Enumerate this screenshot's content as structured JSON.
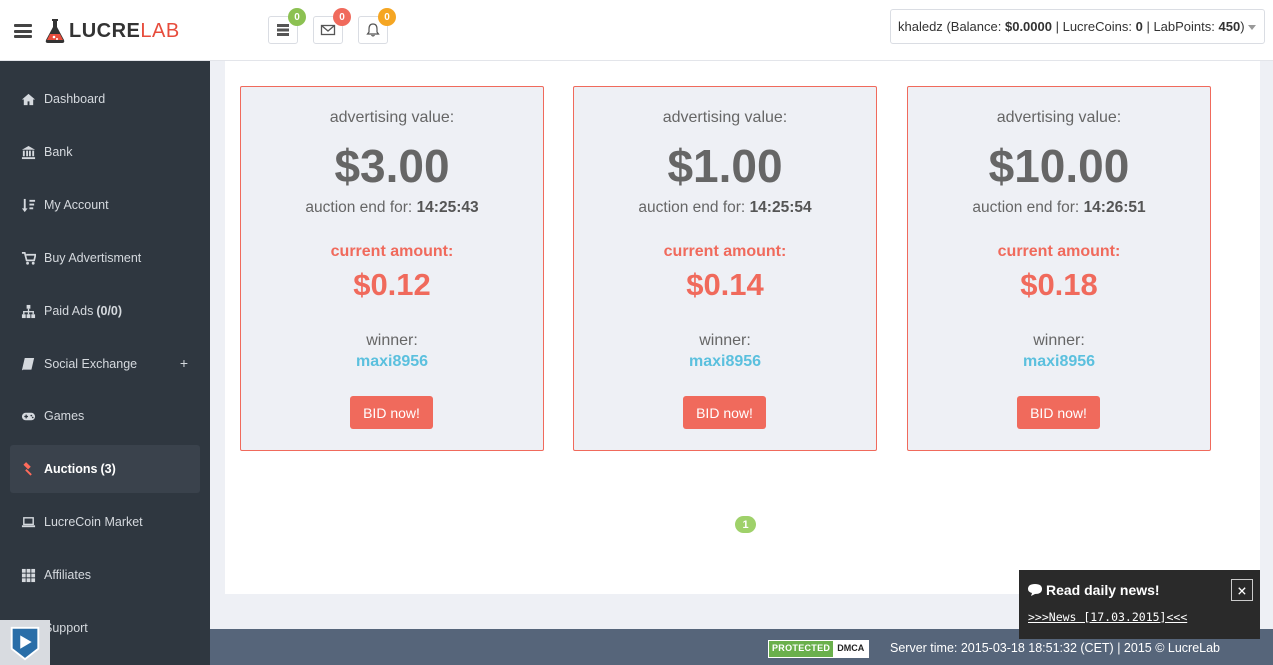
{
  "header": {
    "logo_main": "LUCRE",
    "logo_accent": "LAB",
    "badges": [
      {
        "icon": "server-icon",
        "count": "0",
        "color": "#8cc152"
      },
      {
        "icon": "envelope-icon",
        "count": "0",
        "color": "#f06a5c"
      },
      {
        "icon": "bell-icon",
        "count": "0",
        "color": "#f5a623"
      }
    ],
    "user": {
      "name": "khaledz",
      "balance_label": "(Balance:",
      "balance": "$0.0000",
      "coins_label": "| LucreCoins:",
      "coins": "0",
      "points_label": "| LabPoints:",
      "points": "450",
      "close": ")"
    }
  },
  "sidebar": {
    "items": [
      {
        "label": "Dashboard",
        "icon": "home-icon"
      },
      {
        "label": "Bank",
        "icon": "bank-icon"
      },
      {
        "label": "My Account",
        "icon": "sort-icon"
      },
      {
        "label": "Buy Advertisment",
        "icon": "cart-icon"
      },
      {
        "label": "Paid Ads",
        "count": "(0/0)",
        "icon": "sitemap-icon"
      },
      {
        "label": "Social Exchange",
        "icon": "book-icon",
        "expand": "+"
      },
      {
        "label": "Games",
        "icon": "gamepad-icon"
      },
      {
        "label": "Auctions",
        "count": "(3)",
        "icon": "gavel-icon",
        "active": true
      },
      {
        "label": "LucreCoin Market",
        "icon": "laptop-icon"
      },
      {
        "label": "Affiliates",
        "icon": "grid-icon"
      },
      {
        "label": "Support",
        "icon": "support-icon"
      }
    ]
  },
  "cards": [
    {
      "adv_label": "advertising value:",
      "adv_value": "$3.00",
      "end_label": "auction end for:",
      "end_time": "14:25:43",
      "current_label": "current amount:",
      "current_value": "$0.12",
      "winner_label": "winner:",
      "winner": "maxi8956",
      "bid_label": "BID now!"
    },
    {
      "adv_label": "advertising value:",
      "adv_value": "$1.00",
      "end_label": "auction end for:",
      "end_time": "14:25:54",
      "current_label": "current amount:",
      "current_value": "$0.14",
      "winner_label": "winner:",
      "winner": "maxi8956",
      "bid_label": "BID now!"
    },
    {
      "adv_label": "advertising value:",
      "adv_value": "$10.00",
      "end_label": "auction end for:",
      "end_time": "14:26:51",
      "current_label": "current amount:",
      "current_value": "$0.18",
      "winner_label": "winner:",
      "winner": "maxi8956",
      "bid_label": "BID now!"
    }
  ],
  "pagination": {
    "current": "1"
  },
  "footer": {
    "dmca_protected": "PROTECTED",
    "dmca_label": "DMCA",
    "text": "Server time: 2015-03-18 18:51:32 (CET) | 2015 © LucreLab"
  },
  "news": {
    "title": "Read daily news!",
    "link": ">>>News [17.03.2015]<<<",
    "close": "×"
  },
  "colors": {
    "accent": "#f06a5c",
    "link": "#5bc0de",
    "sidebar": "#2f3740",
    "footer": "#56657a"
  }
}
